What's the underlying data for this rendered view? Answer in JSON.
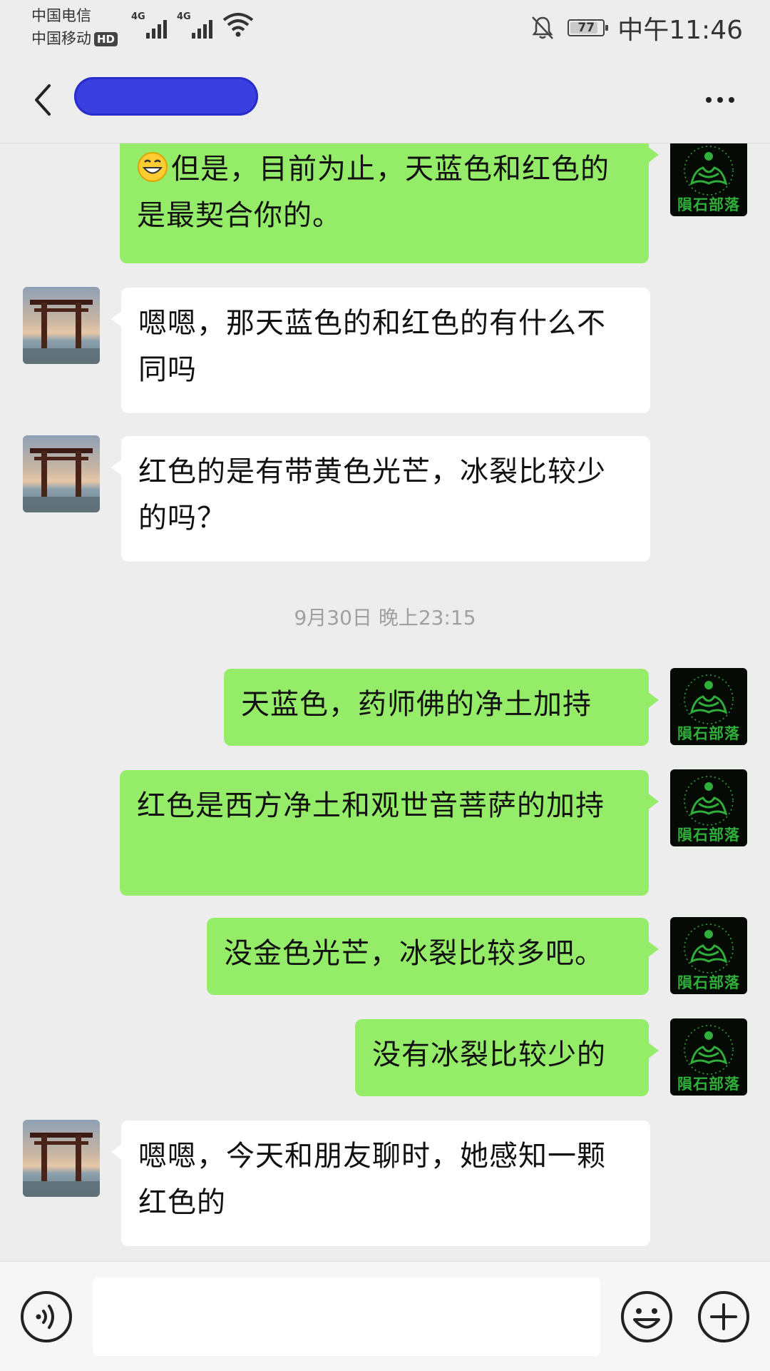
{
  "status_bar": {
    "carrier1": "中国电信",
    "carrier2": "中国移动",
    "hd_badge": "HD",
    "signal1_label": "4G",
    "signal2_label": "4G",
    "battery": "77",
    "time": "中午11:46"
  },
  "header": {
    "back_icon": "back-arrow-icon",
    "contact_name_redacted": true,
    "more_icon": "more-dots-icon"
  },
  "messages": [
    {
      "side": "self",
      "text": "但是，目前为止，天蓝色和红色的是最契合你的。",
      "has_emoji": true
    },
    {
      "side": "other",
      "text": "嗯嗯，那天蓝色的和红色的有什么不同吗"
    },
    {
      "side": "other",
      "text": "红色的是有带黄色光芒，冰裂比较少的吗？"
    },
    {
      "side": "self",
      "text": "天蓝色，药师佛的净土加持"
    },
    {
      "side": "self",
      "text": "红色是西方净土和观世音菩萨的加持"
    },
    {
      "side": "self",
      "text": "没金色光芒，冰裂比较多吧。"
    },
    {
      "side": "self",
      "text": "没有冰裂比较少的"
    },
    {
      "side": "other",
      "text": "嗯嗯，今天和朋友聊时，她感知一颗红色的"
    }
  ],
  "timestamp": "9月30日 晚上23:15",
  "self_avatar_text": "隕石部落",
  "input_bar": {
    "value": "",
    "voice_icon": "voice-icon",
    "emoji_icon": "emoji-icon",
    "plus_icon": "plus-icon"
  },
  "colors": {
    "self_bubble": "#95ec69",
    "other_bubble": "#ffffff",
    "background": "#ededed",
    "self_avatar_green": "#2fae3a"
  }
}
